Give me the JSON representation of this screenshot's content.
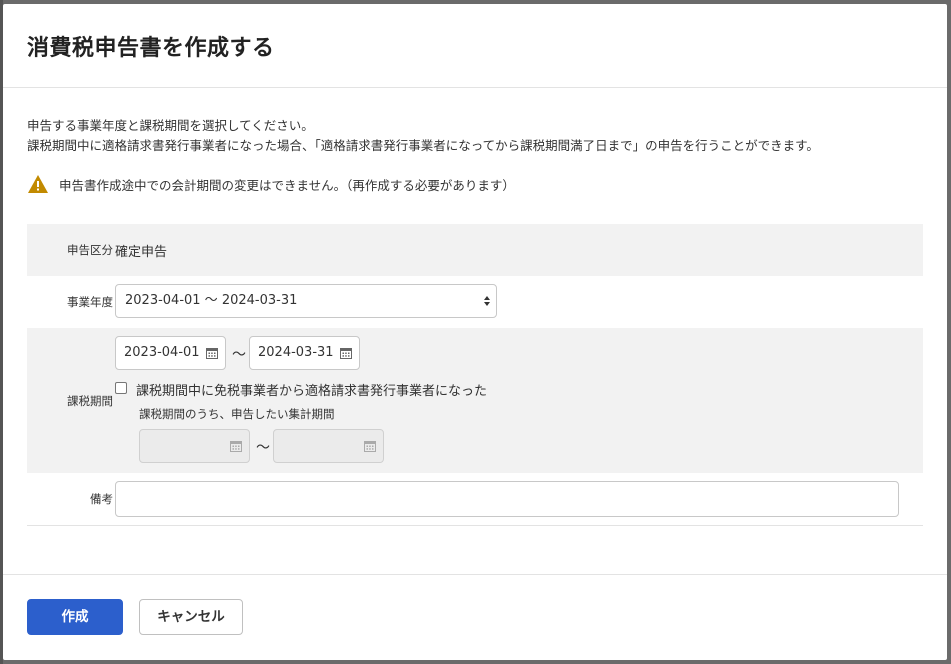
{
  "dialog": {
    "title": "消費税申告書を作成する",
    "description_line1": "申告する事業年度と課税期間を選択してください。",
    "description_line2": "課税期間中に適格請求書発行事業者になった場合、「適格請求書発行事業者になってから課税期間満了日まで」の申告を行うことができます。",
    "warning": "申告書作成途中での会計期間の変更はできません。（再作成する必要があります）"
  },
  "form": {
    "declaration_type": {
      "label": "申告区分",
      "value": "確定申告"
    },
    "fiscal_year": {
      "label": "事業年度",
      "selected": "2023-04-01 〜 2024-03-31"
    },
    "tax_period": {
      "label": "課税期間",
      "start": "2023-04-01",
      "end": "2024-03-31",
      "separator": "〜",
      "checkbox_label": "課税期間中に免税事業者から適格請求書発行事業者になった",
      "checked": false,
      "sub_label": "課税期間のうち、申告したい集計期間",
      "sub_start": "",
      "sub_end": ""
    },
    "memo": {
      "label": "備考",
      "value": ""
    }
  },
  "footer": {
    "create_label": "作成",
    "cancel_label": "キャンセル"
  },
  "colors": {
    "primary": "#2c5fcc",
    "warning": "#c28a00",
    "shaded_row": "#f2f2f2"
  },
  "icons": [
    "warning-icon",
    "calendar-icon",
    "select-arrows-icon"
  ]
}
